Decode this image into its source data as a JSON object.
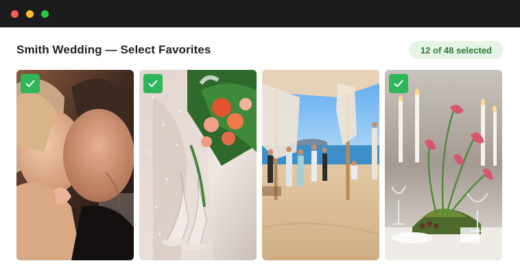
{
  "window": {
    "controls": [
      {
        "name": "close",
        "color": "#fe5f57"
      },
      {
        "name": "minimize",
        "color": "#febc2e"
      },
      {
        "name": "zoom",
        "color": "#28c840"
      }
    ]
  },
  "header": {
    "title": "Smith Wedding — Select Favorites",
    "selection_count": "12 of 48 selected"
  },
  "colors": {
    "accent": "#2fb55a",
    "badge_bg": "#e5f4e6",
    "badge_text": "#2d7a34"
  },
  "photos": [
    {
      "subject": "couple kissing close-up",
      "selected": true,
      "icon": "checkmark-icon"
    },
    {
      "subject": "bride shoes and bouquet",
      "selected": true,
      "icon": "checkmark-icon"
    },
    {
      "subject": "beach ceremony under canopy",
      "selected": false,
      "icon": ""
    },
    {
      "subject": "candlelit table centerpiece",
      "selected": true,
      "icon": "checkmark-icon"
    }
  ]
}
